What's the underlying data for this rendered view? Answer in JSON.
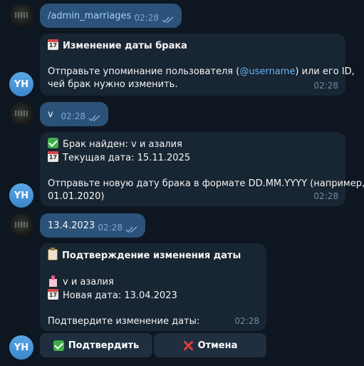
{
  "messages": {
    "m1": {
      "text": "/admin_marriages",
      "time": "02:28"
    },
    "m2": {
      "title": "Изменение даты брака",
      "line1_pre": "Отправьте упоминание пользователя (",
      "mention": "@username",
      "line1_post": ") или его ID,",
      "line2": "чей брак нужно изменить.",
      "time": "02:28"
    },
    "m3": {
      "text": "v",
      "time": "02:28"
    },
    "m4": {
      "line1": "Брак найден: v и азалия",
      "line2": "Текущая дата: 15.11.2025",
      "line3": "Отправьте новую дату брака в формате DD.MM.YYYY (например,",
      "line4": "01.01.2020)",
      "time": "02:28"
    },
    "m5": {
      "text": "13.4.2023",
      "time": "02:28"
    },
    "m6": {
      "title": "Подтверждение изменения даты",
      "line1": "v и азалия",
      "line2": "Новая дата: 13.04.2023",
      "line3": "Подтвердите изменение даты:",
      "time": "02:28"
    }
  },
  "buttons": {
    "confirm": "Подтвердить",
    "cancel": "Отмена"
  },
  "avatars": {
    "bot": "YH"
  },
  "colors": {
    "background": "#0e1621",
    "incoming": "#182533",
    "outgoing": "#2b5278",
    "link": "#6ab2f2"
  },
  "icons": [
    "calendar-icon",
    "check-mark-icon",
    "clipboard-icon",
    "wedding-icon",
    "cross-mark-icon",
    "double-check-icon"
  ]
}
